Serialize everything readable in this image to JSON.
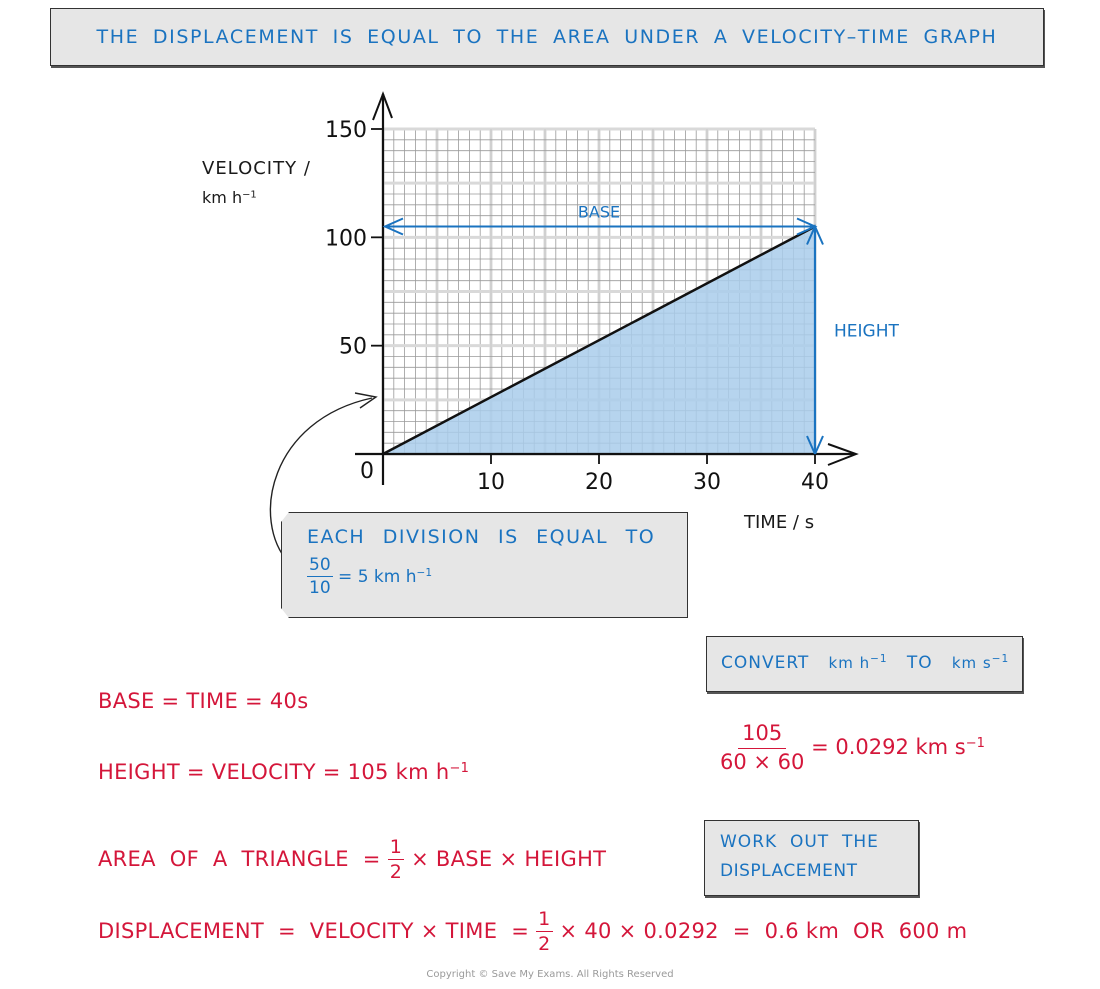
{
  "title": "THE DISPLACEMENT IS EQUAL TO THE AREA UNDER A VELOCITY–TIME GRAPH",
  "colors": {
    "text_blue": "#1a73c0",
    "text_red": "#d4163a",
    "shaded_area": "#a9cdeb",
    "box_fill": "#e6e6e6",
    "grid_minor": "#9a9a9a",
    "grid_major": "#d9d9d9"
  },
  "chart_data": {
    "type": "line",
    "xlabel": "TIME / s",
    "ylabel_line1": "VELOCITY /",
    "ylabel_line2_main": "km h",
    "ylabel_line2_sup": "−1",
    "xlim": [
      0,
      40
    ],
    "ylim": [
      0,
      150
    ],
    "x_ticks": [
      0,
      10,
      20,
      30,
      40
    ],
    "x_tick_labels": [
      "0",
      "10",
      "20",
      "30",
      "40"
    ],
    "y_ticks": [
      50,
      100,
      150
    ],
    "y_tick_labels": [
      "50",
      "100",
      "150"
    ],
    "grid": true,
    "grid_x_step": 1,
    "grid_y_step": 5,
    "series": [
      {
        "name": "velocity",
        "x": [
          0,
          40
        ],
        "y": [
          0,
          105
        ]
      }
    ],
    "shaded_region": "area under line from t=0 to t=40",
    "annotations": {
      "base_label": "BASE",
      "base_value_y": 105,
      "height_label": "HEIGHT",
      "height_value_x": 40
    }
  },
  "note": {
    "line1": "EACH DIVISION IS EQUAL TO",
    "frac_num": "50",
    "frac_den": "10",
    "result_main": "= 5 km h",
    "result_sup": "−1"
  },
  "convert": {
    "label_prefix": "CONVERT",
    "unit_from": "km h",
    "unit_from_sup": "−1",
    "to": "TO",
    "unit_to": "km s",
    "unit_to_sup": "−1",
    "calc_num": "105",
    "calc_den": "60 × 60",
    "calc_result": "= 0.0292 km s",
    "calc_result_sup": "−1"
  },
  "working": {
    "base_line": "BASE = TIME = 40s",
    "height_line": "HEIGHT = VELOCITY = 105 km h",
    "height_sup": "−1",
    "area_prefix": "AREA  OF  A  TRIANGLE  =",
    "half_num": "1",
    "half_den": "2",
    "area_suffix": "× BASE × HEIGHT",
    "disp_prefix": "DISPLACEMENT  =  VELOCITY × TIME  =",
    "disp_suffix": "× 40 × 0.0292  =  0.6 km  OR  600 m"
  },
  "work_box": {
    "line1": "WORK  OUT  THE",
    "line2": "DISPLACEMENT"
  },
  "copyright": "Copyright © Save My Exams. All Rights Reserved"
}
